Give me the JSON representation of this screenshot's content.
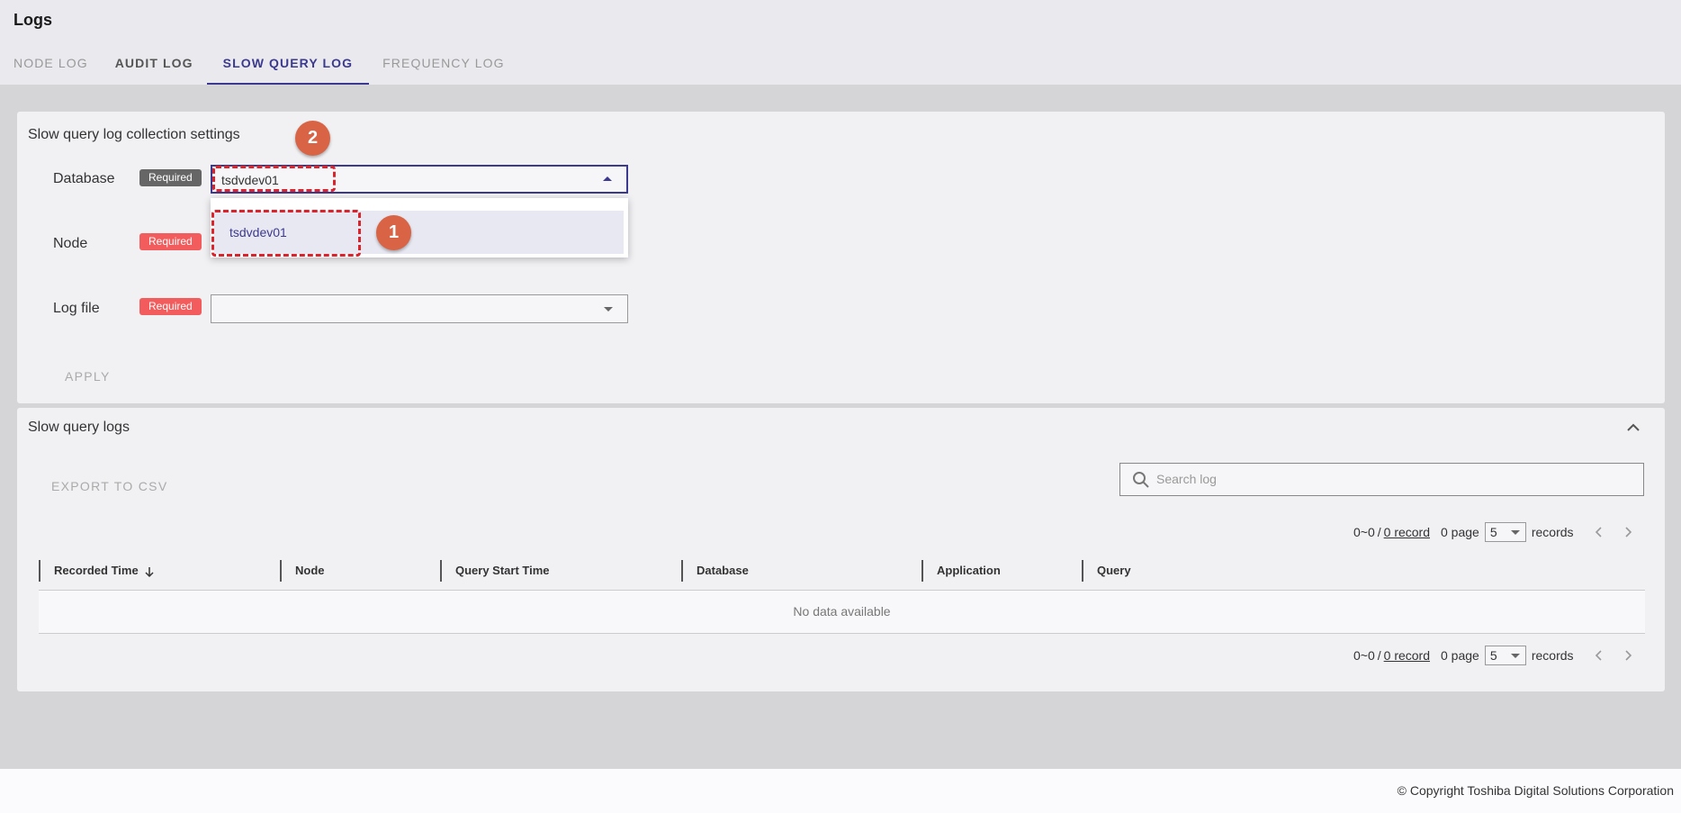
{
  "header": {
    "title": "Logs",
    "tabs": [
      {
        "label": "NODE LOG"
      },
      {
        "label": "AUDIT LOG"
      },
      {
        "label": "SLOW QUERY LOG"
      },
      {
        "label": "FREQUENCY LOG"
      }
    ]
  },
  "settings": {
    "title": "Slow query log collection settings",
    "database": {
      "label": "Database",
      "badge": "Required",
      "value": "tsdvdev01",
      "options": [
        "tsdvdev01"
      ]
    },
    "node": {
      "label": "Node",
      "badge": "Required"
    },
    "log_file": {
      "label": "Log file",
      "badge": "Required",
      "value": ""
    },
    "apply_label": "APPLY"
  },
  "markers": [
    "1",
    "2"
  ],
  "logs": {
    "title": "Slow query logs",
    "export_label": "EXPORT TO CSV",
    "search_placeholder": "Search log",
    "pager": {
      "range": "0~0",
      "slash": "/",
      "records_link": "0 record",
      "page_info": "0 page",
      "page_size": "5",
      "records_label": "records"
    },
    "columns": [
      "Recorded Time",
      "Node",
      "Query Start Time",
      "Database",
      "Application",
      "Query"
    ],
    "empty_text": "No data available"
  },
  "footer": {
    "copyright": "© Copyright Toshiba Digital Solutions Corporation"
  },
  "colors": {
    "accent": "#3c3a8f",
    "required_red": "#f25c5c",
    "marker": "#d96345",
    "highlight_dash": "#d9232d"
  }
}
